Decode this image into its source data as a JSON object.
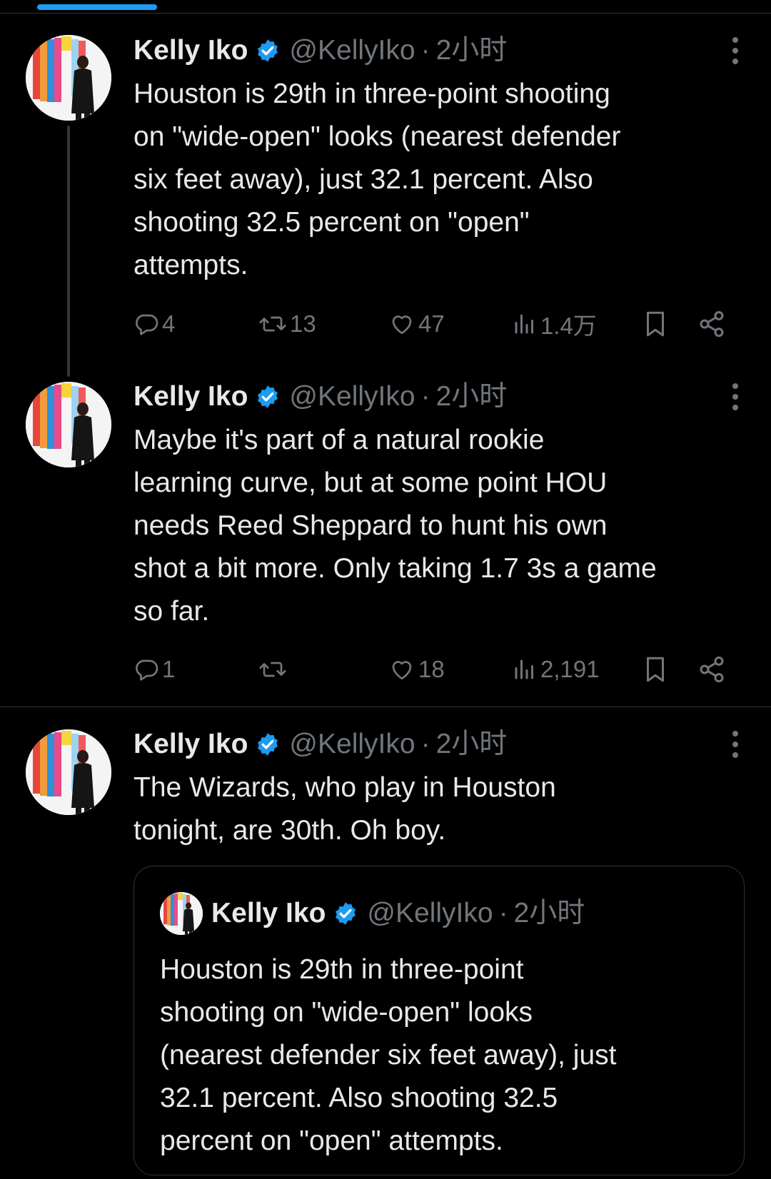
{
  "colors": {
    "background": "#000000",
    "text": "#e7e9ea",
    "muted": "#71767b",
    "accent": "#1d9bf0",
    "border": "#2f3336"
  },
  "tweets": [
    {
      "author": "Kelly Iko",
      "handle": "@KellyIko",
      "separator": "·",
      "time": "2小时",
      "text": "Houston is 29th in three-point shooting\non \"wide-open\" looks (nearest defender\nsix feet away), just 32.1 percent. Also\nshooting 32.5 percent on \"open\"\nattempts.",
      "replies": "4",
      "reposts": "13",
      "likes": "47",
      "views": "1.4万"
    },
    {
      "author": "Kelly Iko",
      "handle": "@KellyIko",
      "separator": "·",
      "time": "2小时",
      "text": "Maybe it's part of a natural rookie\nlearning curve, but at some point HOU\nneeds Reed Sheppard to hunt his own\nshot a bit more. Only taking 1.7 3s a game\nso far.",
      "replies": "1",
      "reposts": "",
      "likes": "18",
      "views": "2,191"
    },
    {
      "author": "Kelly Iko",
      "handle": "@KellyIko",
      "separator": "·",
      "time": "2小时",
      "text": "The Wizards, who play in Houston\ntonight, are 30th. Oh boy.",
      "quote": {
        "author": "Kelly Iko",
        "handle": "@KellyIko",
        "separator": "·",
        "time": "2小时",
        "text": "Houston is 29th in three-point\nshooting on \"wide-open\" looks\n(nearest defender six feet away), just\n32.1 percent. Also shooting 32.5\npercent on \"open\" attempts."
      }
    }
  ],
  "icons": {
    "verified": "verified-badge-icon",
    "more": "more-icon",
    "reply": "reply-icon",
    "repost": "repost-icon",
    "like": "like-icon",
    "views": "views-icon",
    "bookmark": "bookmark-icon",
    "share": "share-icon"
  }
}
